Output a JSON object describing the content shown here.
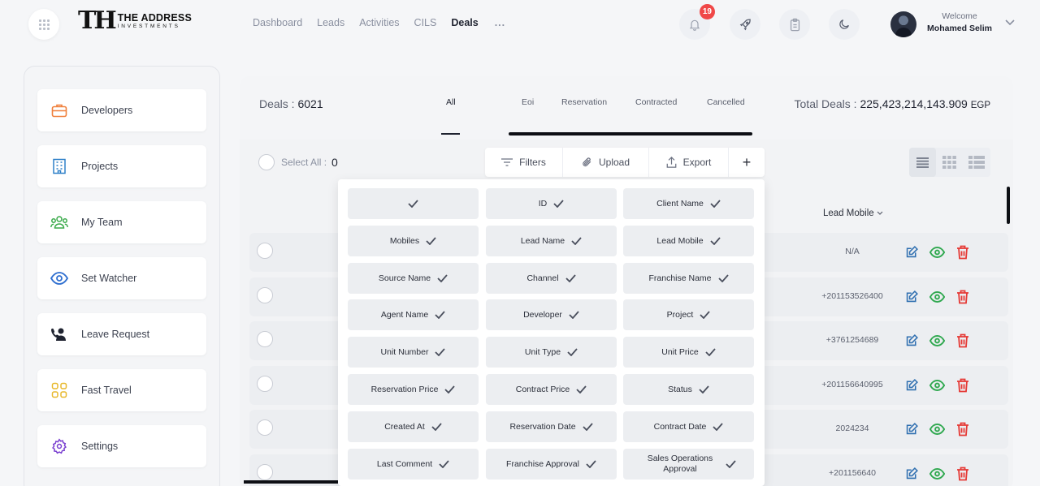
{
  "brand": {
    "mark": "TH",
    "title": "THE ADDRESS",
    "subtitle": "INVESTMENTS"
  },
  "nav": [
    {
      "label": "Dashboard"
    },
    {
      "label": "Leads"
    },
    {
      "label": "Activities"
    },
    {
      "label": "CILS"
    },
    {
      "label": "Deals",
      "active": true
    }
  ],
  "nav_more": "...",
  "notifications": {
    "count": "19",
    "icon": "bell-icon"
  },
  "header_icons": [
    "rocket-icon",
    "clipboard-icon",
    "moon-icon"
  ],
  "user": {
    "welcome": "Welcome",
    "name": "Mohamed Selim"
  },
  "sidebar": {
    "items": [
      {
        "label": "Developers",
        "icon": "briefcase-icon",
        "color": "#f0803c"
      },
      {
        "label": "Projects",
        "icon": "building-icon",
        "color": "#2f80c8"
      },
      {
        "label": "My Team",
        "icon": "team-icon",
        "color": "#3aaa4a"
      },
      {
        "label": "Set Watcher",
        "icon": "eye-icon",
        "color": "#2f6fd0"
      },
      {
        "label": "Leave Request",
        "icon": "phone-person-icon",
        "color": "#1f2330"
      },
      {
        "label": "Fast Travel",
        "icon": "grid-icon",
        "color": "#e8b92e"
      },
      {
        "label": "Settings",
        "icon": "gear-icon",
        "color": "#7a3fd0"
      }
    ]
  },
  "deals": {
    "label": "Deals :",
    "count": "6021",
    "tabs": [
      {
        "label": "All",
        "active": true
      },
      {
        "label": "Eoi"
      },
      {
        "label": "Reservation"
      },
      {
        "label": "Contracted"
      },
      {
        "label": "Cancelled"
      }
    ],
    "total_label": "Total Deals :",
    "total_value": "225,423,214,143.909",
    "currency": "EGP"
  },
  "toolbar": {
    "select_all_label": "Select All :",
    "select_all_count": "0",
    "filters": "Filters",
    "upload": "Upload",
    "export": "Export",
    "add": "+"
  },
  "table": {
    "column_header": "Lead Mobile",
    "rows": [
      {
        "mobile": "N/A"
      },
      {
        "mobile": "+201153526400"
      },
      {
        "mobile": "+3761254689"
      },
      {
        "mobile": "+201156640995"
      },
      {
        "mobile": "2024234"
      },
      {
        "mobile": "+201156640"
      }
    ]
  },
  "columns_menu": [
    {
      "label": ""
    },
    {
      "label": "ID"
    },
    {
      "label": "Client Name"
    },
    {
      "label": "Mobiles"
    },
    {
      "label": "Lead Name"
    },
    {
      "label": "Lead Mobile"
    },
    {
      "label": "Source Name"
    },
    {
      "label": "Channel"
    },
    {
      "label": "Franchise Name"
    },
    {
      "label": "Agent Name"
    },
    {
      "label": "Developer"
    },
    {
      "label": "Project"
    },
    {
      "label": "Unit Number"
    },
    {
      "label": "Unit Type"
    },
    {
      "label": "Unit Price"
    },
    {
      "label": "Reservation Price"
    },
    {
      "label": "Contract Price"
    },
    {
      "label": "Status"
    },
    {
      "label": "Created At"
    },
    {
      "label": "Reservation Date"
    },
    {
      "label": "Contract Date"
    },
    {
      "label": "Last Comment"
    },
    {
      "label": "Franchise Approval"
    },
    {
      "label": "Sales Operations Approval"
    }
  ],
  "colors": {
    "edit": "#2f6fb0",
    "view": "#2fa84f",
    "delete": "#e53935",
    "badge": "#f04848"
  }
}
